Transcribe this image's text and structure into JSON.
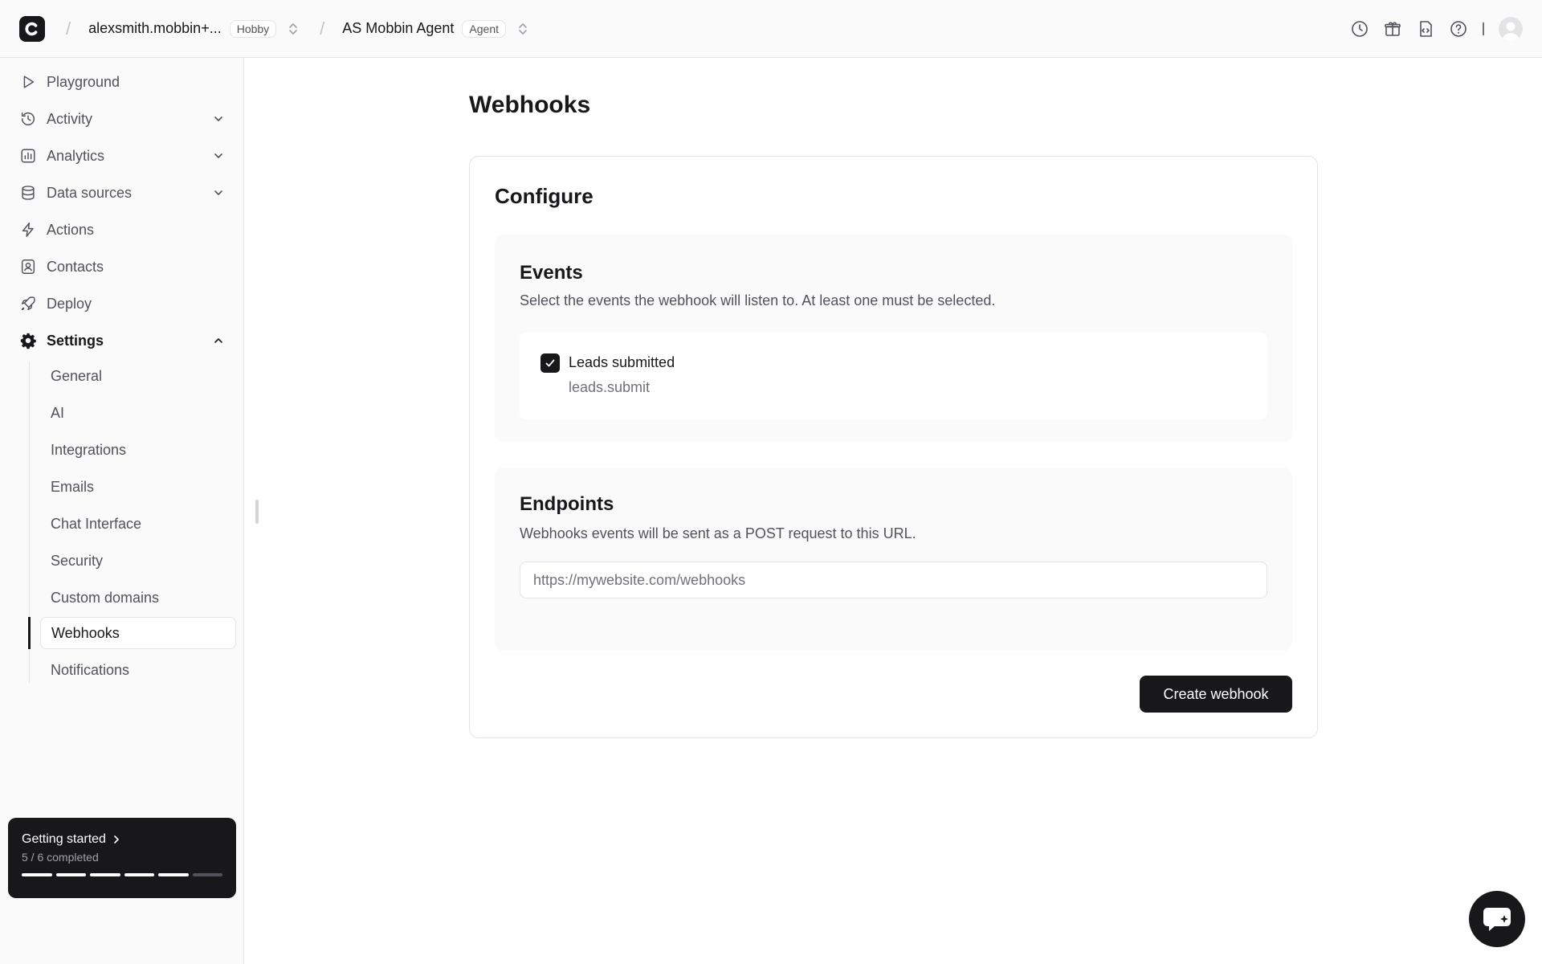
{
  "topbar": {
    "workspace_name": "alexsmith.mobbin+...",
    "workspace_plan": "Hobby",
    "agent_name": "AS Mobbin Agent",
    "agent_badge": "Agent",
    "separator": "/"
  },
  "sidebar": {
    "items": [
      {
        "label": "Playground",
        "icon": "play-icon"
      },
      {
        "label": "Activity",
        "icon": "history-icon"
      },
      {
        "label": "Analytics",
        "icon": "chart-icon"
      },
      {
        "label": "Data sources",
        "icon": "database-icon"
      },
      {
        "label": "Actions",
        "icon": "bolt-icon"
      },
      {
        "label": "Contacts",
        "icon": "contact-icon"
      },
      {
        "label": "Deploy",
        "icon": "rocket-icon"
      },
      {
        "label": "Settings",
        "icon": "gear-icon"
      }
    ],
    "settings_sub": [
      "General",
      "AI",
      "Integrations",
      "Emails",
      "Chat Interface",
      "Security",
      "Custom domains",
      "Webhooks",
      "Notifications"
    ],
    "selected_sub": "Webhooks",
    "getting_started": {
      "title": "Getting started",
      "progress_text": "5 / 6 completed",
      "completed": 5,
      "total": 6
    }
  },
  "main": {
    "page_title": "Webhooks",
    "card_title": "Configure",
    "events": {
      "title": "Events",
      "description": "Select the events the webhook will listen to. At least one must be selected.",
      "items": [
        {
          "label": "Leads submitted",
          "code": "leads.submit",
          "checked": true
        }
      ]
    },
    "endpoints": {
      "title": "Endpoints",
      "description": "Webhooks events will be sent as a POST request to this URL.",
      "placeholder": "https://mywebsite.com/webhooks",
      "value": ""
    },
    "create_button": "Create webhook"
  },
  "colors": {
    "primary": "#18181b",
    "sidebar_bg": "#fafafa",
    "border": "#e4e4e7",
    "muted_text": "#52525b"
  }
}
